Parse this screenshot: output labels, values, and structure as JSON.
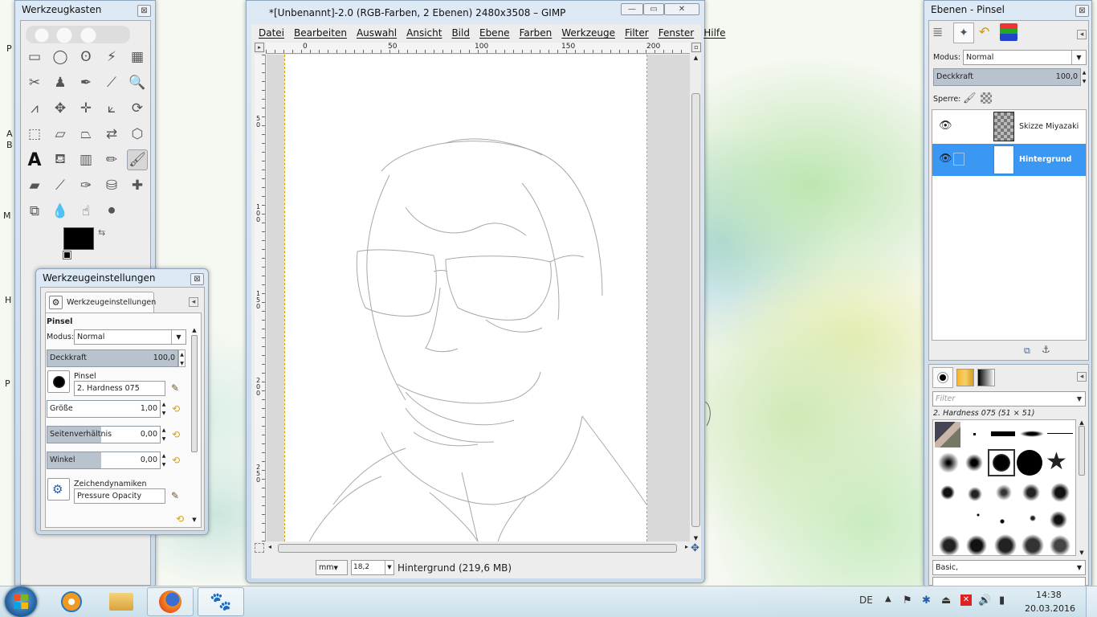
{
  "desktop_edge_letters": [
    "P",
    "A",
    "B",
    "M",
    "H",
    "P"
  ],
  "toolbox": {
    "title": "Werkzeugkasten",
    "close": "⊠",
    "tools": [
      {
        "name": "rect-select-icon",
        "glyph": "▭"
      },
      {
        "name": "ellipse-select-icon",
        "glyph": "◯"
      },
      {
        "name": "free-select-icon",
        "glyph": "ʘ"
      },
      {
        "name": "fuzzy-select-icon",
        "glyph": "⚡"
      },
      {
        "name": "color-select-icon",
        "glyph": "▦"
      },
      {
        "name": "scissors-icon",
        "glyph": "✂"
      },
      {
        "name": "foreground-select-icon",
        "glyph": "♟"
      },
      {
        "name": "paths-icon",
        "glyph": "✒"
      },
      {
        "name": "color-picker-icon",
        "glyph": "⟋"
      },
      {
        "name": "zoom-icon",
        "glyph": "🔍"
      },
      {
        "name": "measure-icon",
        "glyph": "⩘"
      },
      {
        "name": "move-icon",
        "glyph": "✥"
      },
      {
        "name": "align-icon",
        "glyph": "✛"
      },
      {
        "name": "crop-icon",
        "glyph": "⟀"
      },
      {
        "name": "rotate-icon",
        "glyph": "⟳"
      },
      {
        "name": "scale-icon",
        "glyph": "⬚"
      },
      {
        "name": "shear-icon",
        "glyph": "▱"
      },
      {
        "name": "perspective-icon",
        "glyph": "⏢"
      },
      {
        "name": "flip-icon",
        "glyph": "⇄"
      },
      {
        "name": "cage-icon",
        "glyph": "⬡"
      },
      {
        "name": "text-icon",
        "glyph": "A"
      },
      {
        "name": "bucket-fill-icon",
        "glyph": "⛾"
      },
      {
        "name": "gradient-icon",
        "glyph": "▥"
      },
      {
        "name": "pencil-icon",
        "glyph": "✏"
      },
      {
        "name": "paintbrush-icon",
        "glyph": "🖌"
      },
      {
        "name": "eraser-icon",
        "glyph": "▰"
      },
      {
        "name": "airbrush-icon",
        "glyph": "⟋"
      },
      {
        "name": "ink-icon",
        "glyph": "✑"
      },
      {
        "name": "clone-icon",
        "glyph": "⛁"
      },
      {
        "name": "heal-icon",
        "glyph": "✚"
      },
      {
        "name": "perspective-clone-icon",
        "glyph": "⧉"
      },
      {
        "name": "blur-icon",
        "glyph": "💧"
      },
      {
        "name": "smudge-icon",
        "glyph": "☝"
      },
      {
        "name": "dodge-burn-icon",
        "glyph": "⚫"
      }
    ]
  },
  "tool_options": {
    "title": "Werkzeugeinstellungen",
    "tab_label": "Werkzeugeinstellungen",
    "tool_name": "Pinsel",
    "mode_label": "Modus:",
    "mode_value": "Normal",
    "opacity_label": "Deckkraft",
    "opacity_value": "100,0",
    "brush_label": "Pinsel",
    "brush_value": "2. Hardness 075",
    "size_label": "Größe",
    "size_value": "1,00",
    "aspect_label": "Seitenverhältnis",
    "aspect_value": "0,00",
    "angle_label": "Winkel",
    "angle_value": "0,00",
    "dynamics_label": "Zeichendynamiken",
    "dynamics_value": "Pressure Opacity"
  },
  "image_window": {
    "title": "*[Unbenannt]-2.0 (RGB-Farben, 2 Ebenen) 2480x3508 – GIMP",
    "menu": [
      "Datei",
      "Bearbeiten",
      "Auswahl",
      "Ansicht",
      "Bild",
      "Ebene",
      "Farben",
      "Werkzeuge",
      "Filter",
      "Fenster",
      "Hilfe"
    ],
    "hruler": [
      "0",
      "50",
      "100",
      "150",
      "200"
    ],
    "vruler": [
      "5\n0",
      "1\n0\n0",
      "1\n5\n0",
      "2\n0\n0",
      "2\n5\n0"
    ],
    "unit": "mm",
    "zoom": "18,2",
    "status": "Hintergrund (219,6 MB)"
  },
  "layers": {
    "title": "Ebenen - Pinsel",
    "mode_label": "Modus:",
    "mode_value": "Normal",
    "opacity_label": "Deckkraft",
    "opacity_value": "100,0",
    "lock_label": "Sperre:",
    "items": [
      {
        "name": "Skizze Miyazaki",
        "selected": false
      },
      {
        "name": "Hintergrund",
        "selected": true
      }
    ]
  },
  "brushes": {
    "filter_placeholder": "Filter",
    "current": "2. Hardness 075 (51 × 51)",
    "tag": "Basic,"
  },
  "taskbar": {
    "lang": "DE",
    "time": "14:38",
    "date": "20.03.2016"
  }
}
